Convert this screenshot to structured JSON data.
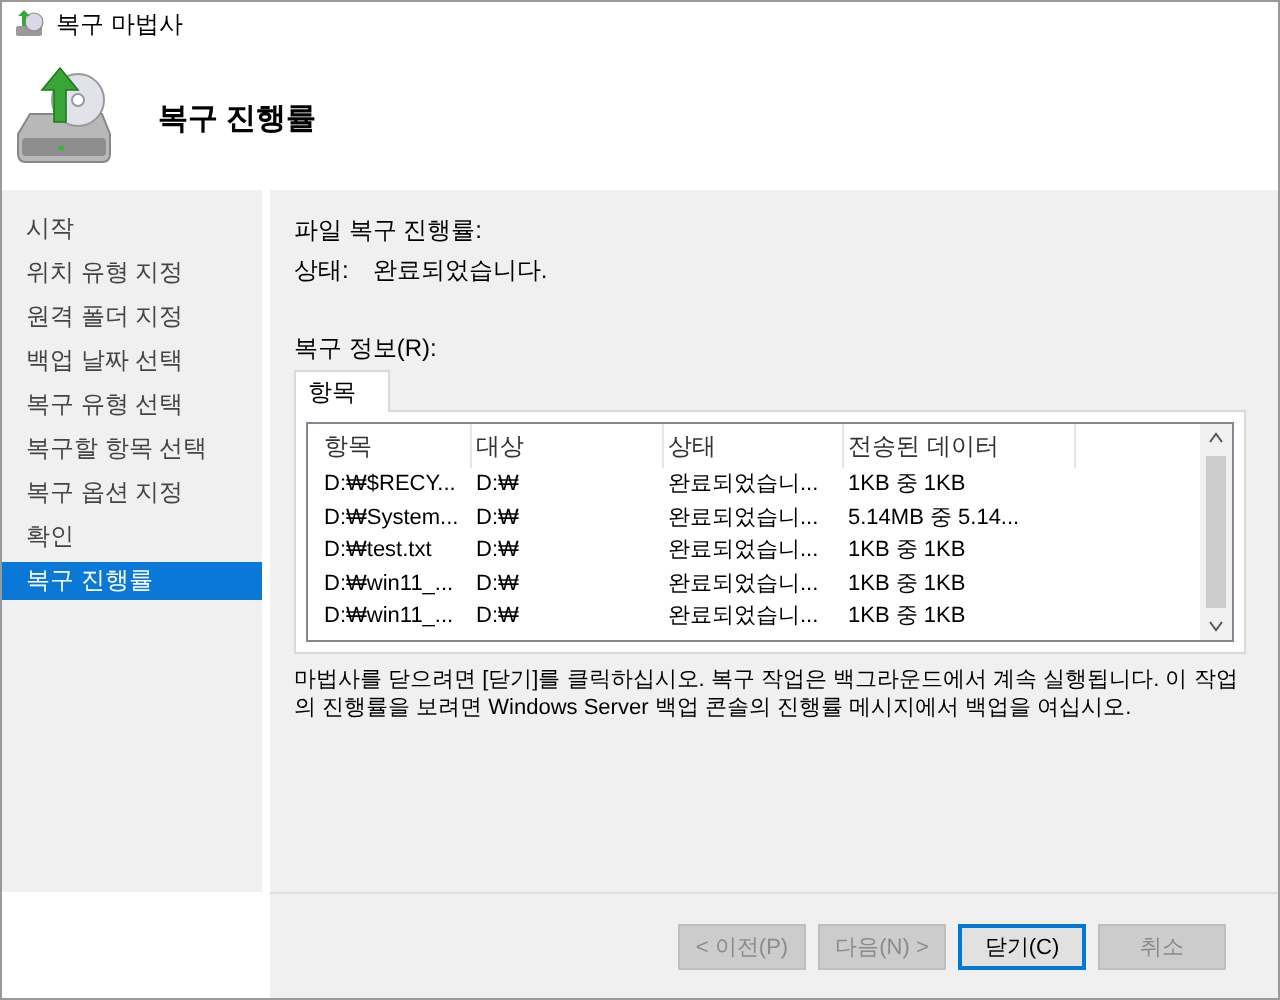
{
  "window": {
    "title": "복구 마법사"
  },
  "header": {
    "title": "복구 진행률"
  },
  "sidebar": {
    "items": [
      {
        "label": "시작",
        "selected": false
      },
      {
        "label": "위치 유형 지정",
        "selected": false
      },
      {
        "label": "원격 폴더 지정",
        "selected": false
      },
      {
        "label": "백업 날짜 선택",
        "selected": false
      },
      {
        "label": "복구 유형 선택",
        "selected": false
      },
      {
        "label": "복구할 항목 선택",
        "selected": false
      },
      {
        "label": "복구 옵션 지정",
        "selected": false
      },
      {
        "label": "확인",
        "selected": false
      },
      {
        "label": "복구 진행률",
        "selected": true
      }
    ]
  },
  "progress": {
    "title": "파일 복구 진행률:",
    "status_label": "상태:",
    "status_value": "완료되었습니다."
  },
  "info": {
    "label": "복구 정보(R):",
    "tabs": [
      {
        "label": "항목",
        "selected": true
      }
    ],
    "table": {
      "columns": [
        "항목",
        "대상",
        "상태",
        "전송된 데이터"
      ],
      "rows": [
        [
          "D:₩$RECY...",
          "D:₩",
          "완료되었습니...",
          "1KB 중 1KB"
        ],
        [
          "D:₩System...",
          "D:₩",
          "완료되었습니...",
          "5.14MB 중 5.14..."
        ],
        [
          "D:₩test.txt",
          "D:₩",
          "완료되었습니...",
          "1KB 중 1KB"
        ],
        [
          "D:₩win11_...",
          "D:₩",
          "완료되었습니...",
          "1KB 중 1KB"
        ],
        [
          "D:₩win11_...",
          "D:₩",
          "완료되었습니...",
          "1KB 중 1KB"
        ]
      ]
    }
  },
  "description": "마법사를 닫으려면 [닫기]를 클릭하십시오. 복구 작업은 백그라운드에서 계속 실행됩니다. 이 작업의 진행률을 보려면 Windows Server 백업 콘솔의 진행률 메시지에서 백업을 여십시오.",
  "buttons": [
    {
      "label": "< 이전(P)",
      "disabled": true,
      "default": false
    },
    {
      "label": "다음(N) >",
      "disabled": true,
      "default": false
    },
    {
      "label": "닫기(C)",
      "disabled": false,
      "default": true
    },
    {
      "label": "취소",
      "disabled": true,
      "default": false
    }
  ]
}
